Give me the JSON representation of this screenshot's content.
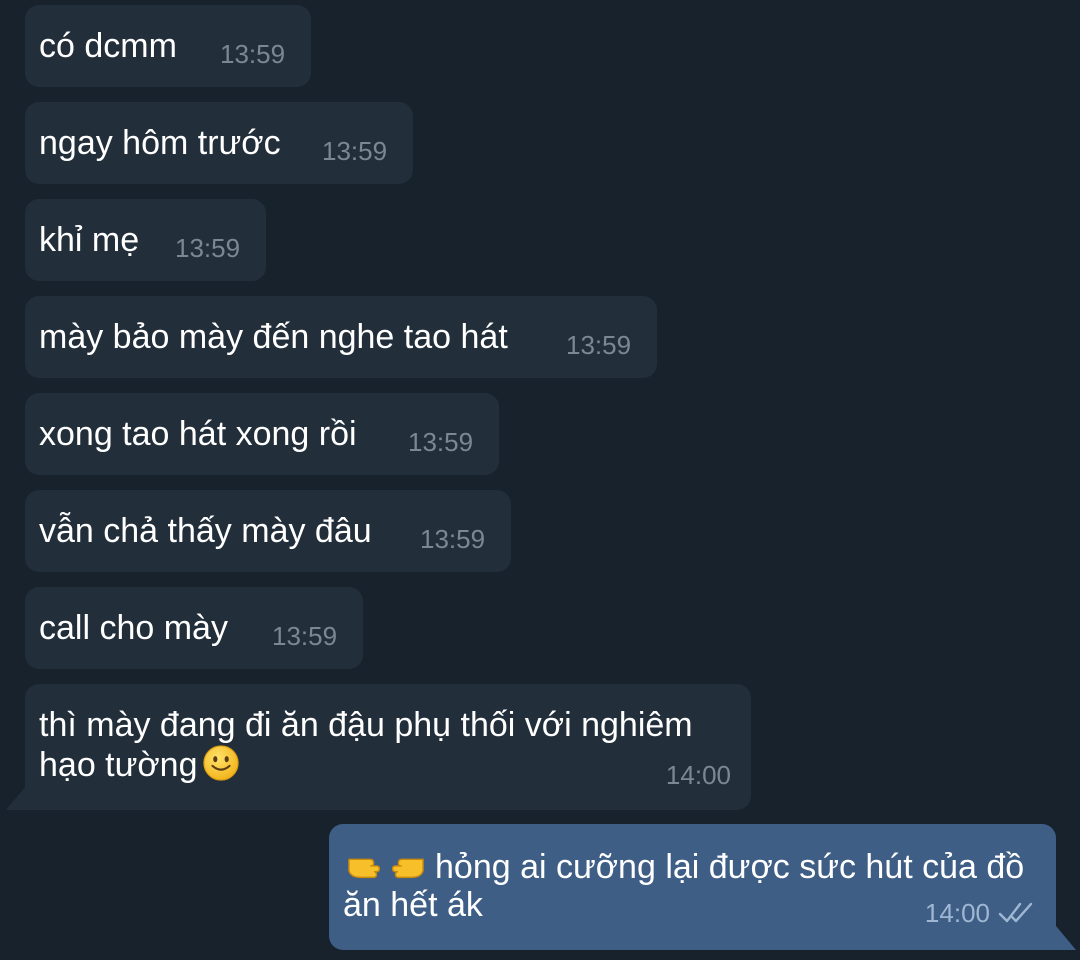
{
  "messages": [
    {
      "text": "có dcmm",
      "time": "13:59"
    },
    {
      "text": "ngay hôm trước",
      "time": "13:59"
    },
    {
      "text": "khỉ mẹ",
      "time": "13:59"
    },
    {
      "text": "mày bảo mày đến nghe tao hát",
      "time": "13:59"
    },
    {
      "text": "xong tao hát xong rồi",
      "time": "13:59"
    },
    {
      "text": "vẫn chả thấy mày đâu",
      "time": "13:59"
    },
    {
      "text": "call cho mày",
      "time": "13:59"
    },
    {
      "text": "thì mày đang đi ăn đậu phụ thối với nghiêm hạo tường",
      "time": "14:00",
      "emoji": "slightly-smiling-face-icon"
    }
  ],
  "outgoing": {
    "text": "hỏng ai cưỡng lại được sức hút của đồ ăn hết ák",
    "time": "14:00",
    "emoji": "pointing-fingers-icon",
    "status": "read-double-check-icon"
  },
  "colors": {
    "background": "#18222d",
    "incoming_bubble": "#222e3a",
    "outgoing_bubble": "#3e5e86",
    "incoming_time": "#7a8895",
    "outgoing_time": "#9fb7d2"
  }
}
